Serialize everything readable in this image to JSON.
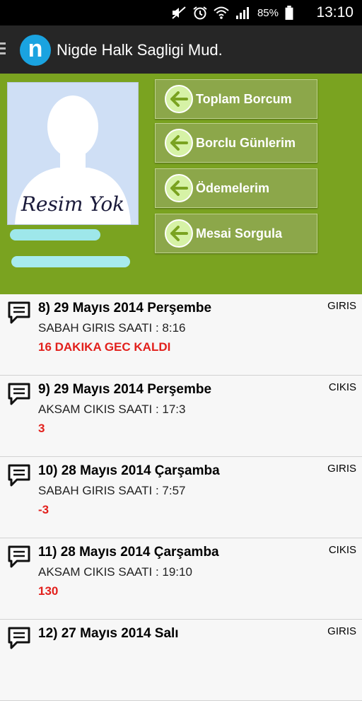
{
  "status_bar": {
    "battery_percent": "85%",
    "time": "13:10",
    "icons": [
      "mute-icon",
      "alarm-icon",
      "wifi-icon",
      "signal-icon",
      "battery-icon"
    ]
  },
  "app_bar": {
    "logo_letter": "n",
    "title": "Nigde Halk Sagligi Mud."
  },
  "profile": {
    "photo_placeholder": "Resim Yok",
    "accent_color": "#7aa320"
  },
  "menu": [
    {
      "label": "Toplam Borcum"
    },
    {
      "label": "Borclu Günlerim"
    },
    {
      "label": "Ödemelerim"
    },
    {
      "label": "Mesai Sorgula"
    }
  ],
  "records": [
    {
      "title": "8) 29 Mayıs 2014 Perşembe",
      "kind": "GIRIS",
      "detail": "SABAH GIRIS SAATI : 8:16",
      "note": "16  DAKIKA GEC KALDI"
    },
    {
      "title": "9) 29 Mayıs 2014 Perşembe",
      "kind": "CIKIS",
      "detail": "AKSAM CIKIS SAATI : 17:3",
      "note": "3"
    },
    {
      "title": "10) 28 Mayıs 2014 Çarşamba",
      "kind": "GIRIS",
      "detail": "SABAH GIRIS SAATI : 7:57",
      "note": "-3"
    },
    {
      "title": "11) 28 Mayıs 2014 Çarşamba",
      "kind": "CIKIS",
      "detail": "AKSAM CIKIS SAATI : 19:10",
      "note": "130"
    },
    {
      "title": "12) 27 Mayıs 2014 Salı",
      "kind": "GIRIS",
      "detail": "",
      "note": ""
    }
  ]
}
